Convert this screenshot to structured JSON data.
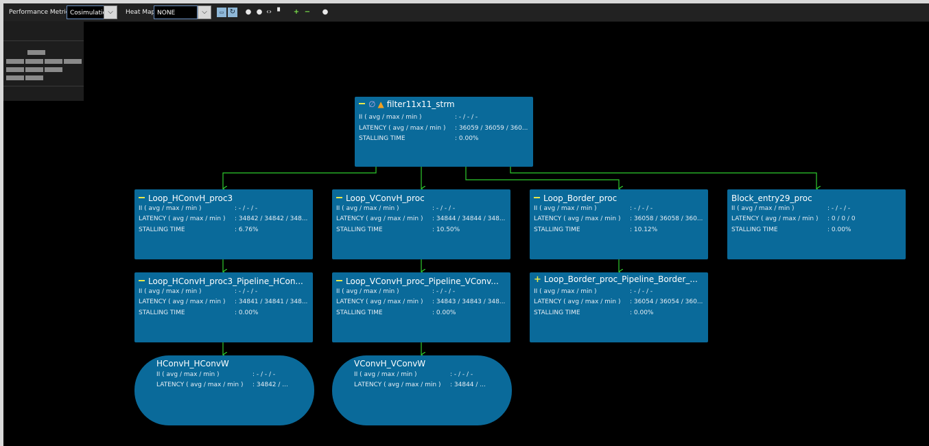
{
  "toolbar": {
    "perf_label": "Performance Metrics",
    "perf_value": "Cosimulation",
    "heat_label": "Heat Map",
    "heat_value": "NONE"
  },
  "nodes": {
    "top": {
      "title": "filter11x11_strm",
      "ii_label": "II ( avg / max / min )",
      "ii_value": ": - / - / -",
      "lat_label": "LATENCY ( avg / max / min )",
      "lat_value": ": 36059 / 36059 / 360...",
      "stall_label": "STALLING TIME",
      "stall_value": ": 0.00%"
    },
    "hconv": {
      "title": "Loop_HConvH_proc3",
      "ii_label": "II ( avg / max / min )",
      "ii_value": ": - / - / -",
      "lat_label": "LATENCY ( avg / max / min )",
      "lat_value": ": 34842 / 34842 / 348...",
      "stall_label": "STALLING TIME",
      "stall_value": ": 6.76%"
    },
    "vconv": {
      "title": "Loop_VConvH_proc",
      "ii_label": "II ( avg / max / min )",
      "ii_value": ": - / - / -",
      "lat_label": "LATENCY ( avg / max / min )",
      "lat_value": ": 34844 / 34844 / 348...",
      "stall_label": "STALLING TIME",
      "stall_value": ": 10.50%"
    },
    "border": {
      "title": "Loop_Border_proc",
      "ii_label": "II ( avg / max / min )",
      "ii_value": ": - / - / -",
      "lat_label": "LATENCY ( avg / max / min )",
      "lat_value": ": 36058 / 36058 / 360...",
      "stall_label": "STALLING TIME",
      "stall_value": ": 10.12%"
    },
    "block": {
      "title": "Block_entry29_proc",
      "ii_label": "II ( avg / max / min )",
      "ii_value": ": - / - / -",
      "lat_label": "LATENCY ( avg / max / min )",
      "lat_value": ": 0 / 0 / 0",
      "stall_label": "STALLING TIME",
      "stall_value": ": 0.00%"
    },
    "hconv_pipe": {
      "title": "Loop_HConvH_proc3_Pipeline_HCon...",
      "ii_label": "II ( avg / max / min )",
      "ii_value": ": - / - / -",
      "lat_label": "LATENCY ( avg / max / min )",
      "lat_value": ": 34841 / 34841 / 348...",
      "stall_label": "STALLING TIME",
      "stall_value": ": 0.00%"
    },
    "vconv_pipe": {
      "title": "Loop_VConvH_proc_Pipeline_VConv...",
      "ii_label": "II ( avg / max / min )",
      "ii_value": ": - / - / -",
      "lat_label": "LATENCY ( avg / max / min )",
      "lat_value": ": 34843 / 34843 / 348...",
      "stall_label": "STALLING TIME",
      "stall_value": ": 0.00%"
    },
    "border_pipe": {
      "title": "Loop_Border_proc_Pipeline_Border_...",
      "ii_label": "II ( avg / max / min )",
      "ii_value": ": - / - / -",
      "lat_label": "LATENCY ( avg / max / min )",
      "lat_value": ": 36054 / 36054 / 360...",
      "stall_label": "STALLING TIME",
      "stall_value": ": 0.00%"
    },
    "hconvw": {
      "title": "HConvH_HConvW",
      "ii_label": "II ( avg / max / min )",
      "ii_value": ": - / - / -",
      "lat_label": "LATENCY ( avg / max / min )",
      "lat_value": ": 34842 / ..."
    },
    "vconvw": {
      "title": "VConvH_VConvW",
      "ii_label": "II ( avg / max / min )",
      "ii_value": ": - / - / -",
      "lat_label": "LATENCY ( avg / max / min )",
      "lat_value": ": 34844 / ..."
    }
  },
  "colors": {
    "node": "#0a6a9a",
    "edge": "#2ecc2e",
    "accent": "#e8e84a"
  }
}
